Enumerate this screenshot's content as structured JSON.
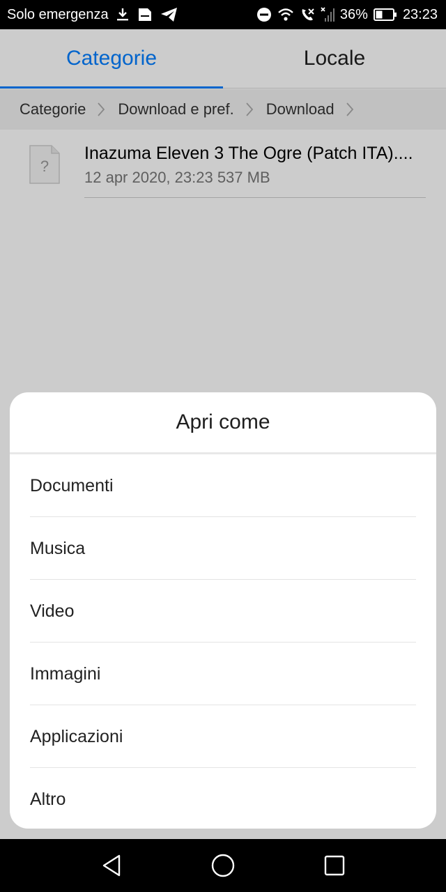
{
  "status_bar": {
    "carrier": "Solo emergenza",
    "battery": "36%",
    "time": "23:23"
  },
  "tabs": [
    {
      "label": "Categorie",
      "active": true
    },
    {
      "label": "Locale",
      "active": false
    }
  ],
  "breadcrumb": [
    "Categorie",
    "Download e pref.",
    "Download"
  ],
  "file": {
    "name": "Inazuma Eleven 3 The Ogre (Patch ITA)....",
    "meta": "12 apr 2020, 23:23 537 MB",
    "icon": "unknown-file-icon"
  },
  "dialog": {
    "title": "Apri come",
    "options": [
      "Documenti",
      "Musica",
      "Video",
      "Immagini",
      "Applicazioni",
      "Altro"
    ]
  },
  "colors": {
    "accent": "#007dff",
    "status_bar": "#000000",
    "dim_overlay": "rgba(0,0,0,0.2)"
  }
}
